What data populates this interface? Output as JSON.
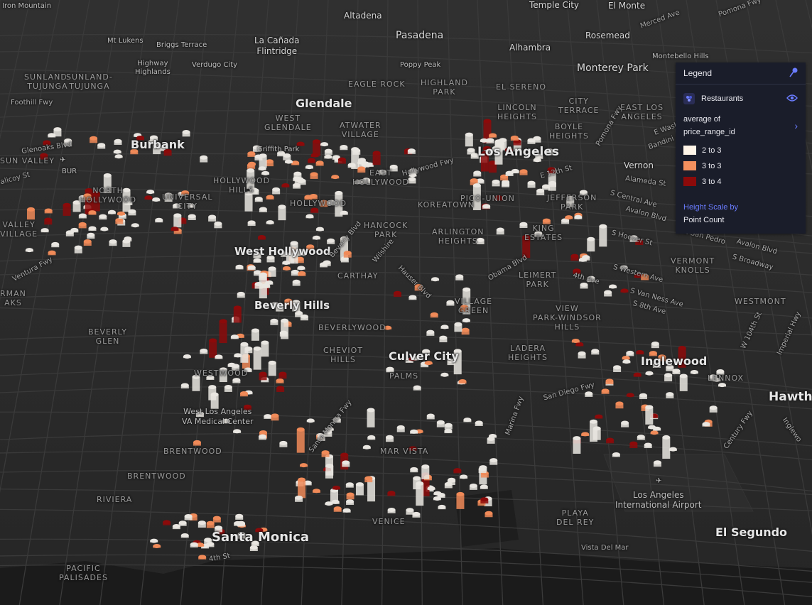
{
  "map": {
    "places": {
      "iron_mountain": "Iron Mountain",
      "altadena": "Altadena",
      "temple_city": "Temple City",
      "el_monte": "El Monte",
      "mt_lukens": "Mt Lukens",
      "briggs_terrace": "Briggs Terrace",
      "la_canada": "La Cañada\nFlintridge",
      "pasadena": "Pasadena",
      "rosemead": "Rosemead",
      "merced_ave": "Merced Ave",
      "pomona_fwy_top": "Pomona Fwy",
      "alhambra": "Alhambra",
      "montebello_hills": "Montebello Hills",
      "sunland_tujunga_1": "SUNLAND-\nTUJUNGA",
      "sunland_tujunga_2": "SUNLAND-\nTUJUNGA",
      "highway_highlands": "Highway\nHighlands",
      "verdugo_city": "Verdugo City",
      "poppy_peak": "Poppy Peak",
      "monterey_park": "Monterey Park",
      "eagle_rock": "EAGLE ROCK",
      "highland_park": "HIGHLAND\nPARK",
      "el_sereno": "EL SERENO",
      "foothill_fwy": "Foothill Fwy",
      "glendale": "Glendale",
      "west_glendale": "WEST\nGLENDALE",
      "atwater_village": "ATWATER\nVILLAGE",
      "lincoln_heights": "LINCOLN\nHEIGHTS",
      "city_terrace": "CITY\nTERRACE",
      "east_los_angeles": "EAST LOS\nANGELES",
      "glenoaks": "Glenoaks Blvd",
      "burbank": "Burbank",
      "griffith_park": "Griffith Park",
      "boyle_heights": "BOYLE\nHEIGHTS",
      "pomona_fwy": "Pomona Fwy",
      "e_washington": "E Wash",
      "bandini": "Bandini",
      "sun_valley": "SUN VALLEY",
      "bur": "BUR",
      "los_angeles": "Los Angeles",
      "hollywood_fwy": "Hollywood Fwy",
      "e_12th_st": "E 12th St",
      "vernon": "Vernon",
      "alameda_st": "Alameda St",
      "talcy_st": "alicoy St",
      "hollywood_hills": "HOLLYWOOD\nHILLS",
      "east_hollywood": "EAST\nHOLLYWOOD",
      "north_hollywood": "NORTH\nHOLLYWOOD",
      "universal_city": "UNIVERSAL\nCITY",
      "pico_union": "PICO-UNION",
      "koreatown": "KOREATOWN",
      "hollywood": "HOLLYWOOD",
      "jefferson_park": "JEFFERSON\nPARK",
      "s_central_ave": "S Central Ave",
      "avalon_blvd_1": "Avalon Blvd",
      "valley_village": "VALLEY\nVILLAGE",
      "hancock_park": "HANCOCK\nPARK",
      "arlington_heights": "ARLINGTON\nHEIGHTS",
      "king_estates": "KING\nESTATES",
      "s_hoover_st": "S Hoover St",
      "e_san_pedro": "E San Pedro",
      "avalon_blvd_2": "Avalon Blvd",
      "ventura_fwy": "Ventura Fwy",
      "west_hollywood": "West Hollywood",
      "beverly_blvd": "Beverly Blvd",
      "wilshire": "Wilshire",
      "carthay": "CARTHAY",
      "obama_blvd": "Obama Blvd",
      "vermont_knolls": "VERMONT\nKNOLLS",
      "s_broadway": "S Broadway",
      "sherman_oaks": "RMAN\nAKS",
      "leimert_park": "LEIMERT\nPARK",
      "fourth_ave": "4th Ave",
      "s_western_ave": "S Western Ave",
      "hauser_blvd": "Hauser Blvd",
      "s_van_ness": "S Van Ness Ave",
      "s_8th_ave": "S 8th Ave",
      "westmont": "WESTMONT",
      "beverly_hills": "Beverly Hills",
      "village_green": "VILLAGE\nGREEN",
      "view_park": "VIEW\nPARK-WINDSOR\nHILLS",
      "w_104th": "W 104th St",
      "imperial_hwy": "Imperial Hwy",
      "beverly_glen": "BEVERLY\nGLEN",
      "beverlywood": "BEVERLYWOOD",
      "cheviot_hills": "CHEVIOT\nHILLS",
      "culver_city": "Culver City",
      "ladera_heights": "LADERA\nHEIGHTS",
      "inglewood": "Inglewood",
      "westwood": "WESTWOOD",
      "palms": "PALMS",
      "lennox": "LENNOX",
      "hawthorne": "Hawtho",
      "san_diego_fwy": "San Diego Fwy",
      "west_la_va": "West Los Angeles\nVA Medical Center",
      "santa_monica_fwy": "Santa Monica Fwy",
      "marina_fwy": "Marina Fwy",
      "century_fwy": "Century Fwy",
      "brentwood_1": "BRENTWOOD",
      "mar_vista": "MAR VISTA",
      "brentwood_2": "BRENTWOOD",
      "riviera": "RIVIERA",
      "lax": "Los Angeles\nInternational Airport",
      "playa_del_rey": "PLAYA\nDEL REY",
      "venice": "VENICE",
      "el_segundo": "El Segundo",
      "santa_monica": "Santa Monica",
      "fourth_st": "4th St",
      "vista_del_mar": "Vista Del Mar",
      "pacific_palisades": "PACIFIC\nPALISADES",
      "inglewood_side": "Inglewo"
    }
  },
  "legend": {
    "title": "Legend",
    "layer_name": "Restaurants",
    "color_by_label": "average of",
    "color_field": "price_range_id",
    "bins": [
      {
        "label": "2 to 3",
        "color": "#fff5e8"
      },
      {
        "label": "3 to 3",
        "color": "#f4905e"
      },
      {
        "label": "3 to 4",
        "color": "#8c0a0a"
      }
    ],
    "height_label": "Height Scale by",
    "height_field": "Point Count",
    "icons": {
      "pin": "pin-icon",
      "layer": "hexbin-layer-icon",
      "eye": "eye-icon",
      "expand": "chevron-right-icon"
    }
  }
}
